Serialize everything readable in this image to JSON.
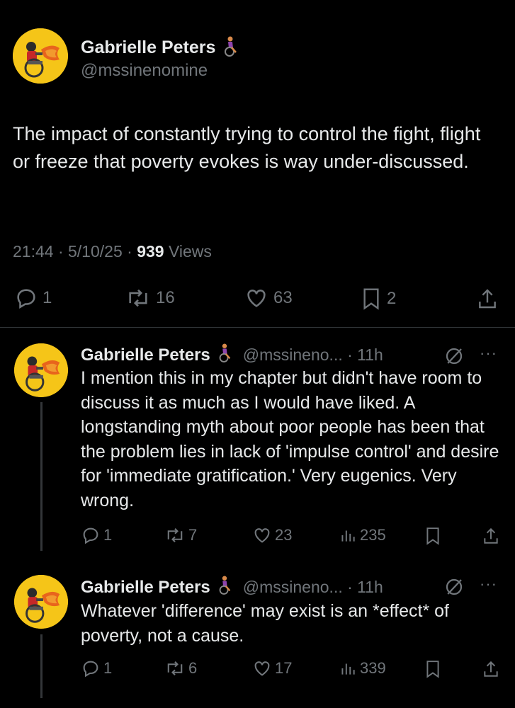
{
  "main_post": {
    "author_name": "Gabrielle Peters",
    "author_handle": "@mssinenomine",
    "text": "The impact of constantly trying to control the fight, flight or freeze that poverty evokes is way under-discussed.",
    "time": "21:44 · 5/10/25 ·",
    "views_count": "939",
    "views_label": "Views",
    "replies": "1",
    "reposts": "16",
    "likes": "63",
    "bookmarks": "2"
  },
  "replies": [
    {
      "author_name": "Gabrielle Peters",
      "author_handle": "@mssineno... · 11h",
      "text": "I mention this in my chapter but didn't have room to discuss it as much as I would have liked. A longstanding myth about poor people has been that the problem lies in lack of 'impulse control' and desire for 'immediate gratification.' Very eugenics. Very wrong.",
      "replies": "1",
      "reposts": "7",
      "likes": "23",
      "views": "235"
    },
    {
      "author_name": "Gabrielle Peters",
      "author_handle": "@mssineno... · 11h",
      "text": "Whatever 'difference' may exist is an *effect* of poverty, not a cause.",
      "replies": "1",
      "reposts": "6",
      "likes": "17",
      "views": "339"
    }
  ],
  "colors": {
    "background": "#000000",
    "text": "#e7e9ea",
    "muted": "#71767b",
    "divider": "#2f3336",
    "avatar_bg": "#f5c518"
  },
  "icons": [
    "wheelchair-emoji",
    "reply-icon",
    "repost-icon",
    "like-icon",
    "bookmark-icon",
    "share-icon",
    "views-icon",
    "grok-icon",
    "more-icon"
  ]
}
